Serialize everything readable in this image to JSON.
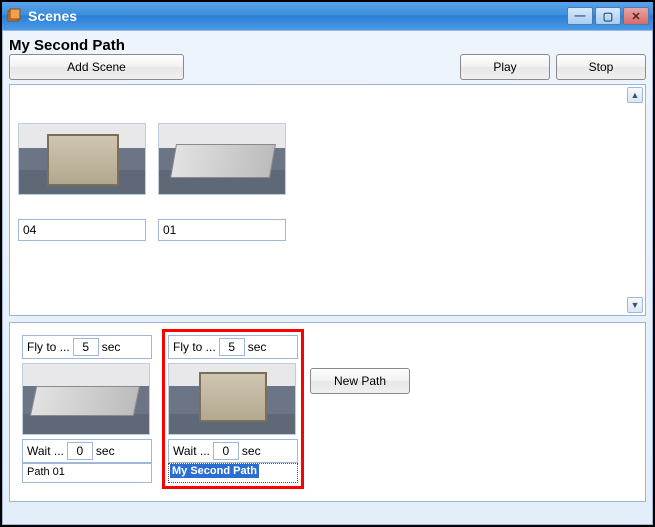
{
  "window": {
    "title": "Scenes"
  },
  "header": {
    "path_title": "My Second Path",
    "add_scene": "Add Scene",
    "play": "Play",
    "stop": "Stop"
  },
  "scenes": [
    {
      "value": "04"
    },
    {
      "value": "01"
    }
  ],
  "paths": [
    {
      "fly_label": "Fly to ...",
      "fly_value": "5",
      "fly_unit": "sec",
      "wait_label": "Wait ...",
      "wait_value": "0",
      "wait_unit": "sec",
      "name": "Path 01",
      "selected": false
    },
    {
      "fly_label": "Fly to ...",
      "fly_value": "5",
      "fly_unit": "sec",
      "wait_label": "Wait ...",
      "wait_value": "0",
      "wait_unit": "sec",
      "name": "My Second Path",
      "selected": true
    }
  ],
  "new_path": "New Path"
}
